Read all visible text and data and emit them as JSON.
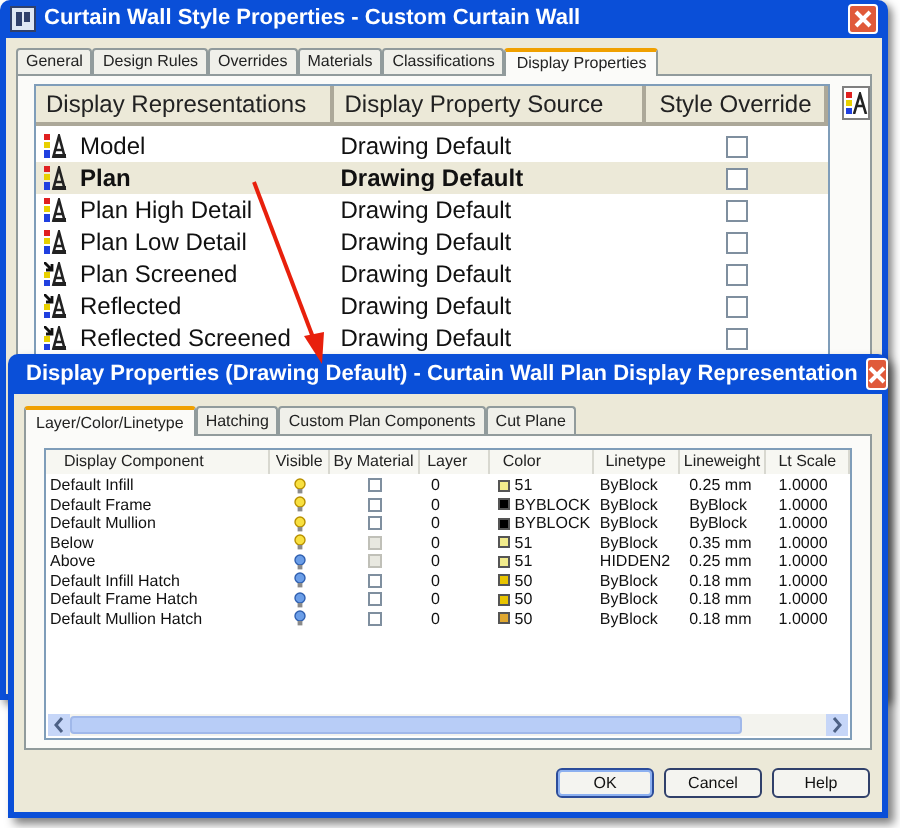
{
  "back_window": {
    "title": "Curtain Wall Style Properties - Custom Curtain Wall",
    "tabs": [
      {
        "label": "General",
        "selected": false
      },
      {
        "label": "Design Rules",
        "selected": false
      },
      {
        "label": "Overrides",
        "selected": false
      },
      {
        "label": "Materials",
        "selected": false
      },
      {
        "label": "Classifications",
        "selected": false
      },
      {
        "label": "Display Properties",
        "selected": true
      }
    ],
    "columns": [
      "Display Representations",
      "Display Property Source",
      "Style Override"
    ],
    "rows": [
      {
        "kind": "standard",
        "name": "Model",
        "source": "Drawing Default",
        "style_override": false,
        "selected": false
      },
      {
        "kind": "standard",
        "name": "Plan",
        "source": "Drawing Default",
        "style_override": false,
        "selected": true
      },
      {
        "kind": "standard",
        "name": "Plan High Detail",
        "source": "Drawing Default",
        "style_override": false,
        "selected": false
      },
      {
        "kind": "standard",
        "name": "Plan Low Detail",
        "source": "Drawing Default",
        "style_override": false,
        "selected": false
      },
      {
        "kind": "screened",
        "name": "Plan Screened",
        "source": "Drawing Default",
        "style_override": false,
        "selected": false
      },
      {
        "kind": "screened",
        "name": "Reflected",
        "source": "Drawing Default",
        "style_override": false,
        "selected": false
      },
      {
        "kind": "screened",
        "name": "Reflected Screened",
        "source": "Drawing Default",
        "style_override": false,
        "selected": false
      }
    ]
  },
  "front_window": {
    "title": "Display Properties (Drawing Default) - Curtain Wall Plan Display Representation",
    "tabs": [
      {
        "label": "Layer/Color/Linetype",
        "selected": true
      },
      {
        "label": "Hatching",
        "selected": false
      },
      {
        "label": "Custom Plan Components",
        "selected": false
      },
      {
        "label": "Cut Plane",
        "selected": false
      }
    ],
    "columns": [
      "Display Component",
      "Visible",
      "By Material",
      "Layer",
      "Color",
      "Linetype",
      "Lineweight",
      "Lt Scale"
    ],
    "rows": [
      {
        "component": "Default Infill",
        "visible": true,
        "by_material": false,
        "by_material_disabled": false,
        "layer": "0",
        "color_text": "51",
        "color": "#f2ec8c",
        "linetype": "ByBlock",
        "lineweight": "0.25 mm",
        "lt_scale": "1.0000"
      },
      {
        "component": "Default Frame",
        "visible": true,
        "by_material": false,
        "by_material_disabled": false,
        "layer": "0",
        "color_text": "BYBLOCK",
        "color": "#000000",
        "linetype": "ByBlock",
        "lineweight": "ByBlock",
        "lt_scale": "1.0000"
      },
      {
        "component": "Default Mullion",
        "visible": true,
        "by_material": false,
        "by_material_disabled": false,
        "layer": "0",
        "color_text": "BYBLOCK",
        "color": "#000000",
        "linetype": "ByBlock",
        "lineweight": "ByBlock",
        "lt_scale": "1.0000"
      },
      {
        "component": "Below",
        "visible": true,
        "by_material": false,
        "by_material_disabled": true,
        "layer": "0",
        "color_text": "51",
        "color": "#f2ec8c",
        "linetype": "ByBlock",
        "lineweight": "0.35 mm",
        "lt_scale": "1.0000"
      },
      {
        "component": "Above",
        "visible": false,
        "by_material": false,
        "by_material_disabled": true,
        "layer": "0",
        "color_text": "51",
        "color": "#f2ec8c",
        "linetype": "HIDDEN2",
        "lineweight": "0.25 mm",
        "lt_scale": "1.0000"
      },
      {
        "component": "Default Infill Hatch",
        "visible": false,
        "by_material": false,
        "by_material_disabled": false,
        "layer": "0",
        "color_text": "50",
        "color": "#e8c400",
        "linetype": "ByBlock",
        "lineweight": "0.18 mm",
        "lt_scale": "1.0000"
      },
      {
        "component": "Default Frame Hatch",
        "visible": false,
        "by_material": false,
        "by_material_disabled": false,
        "layer": "0",
        "color_text": "50",
        "color": "#e8c400",
        "linetype": "ByBlock",
        "lineweight": "0.18 mm",
        "lt_scale": "1.0000"
      },
      {
        "component": "Default Mullion Hatch",
        "visible": false,
        "by_material": false,
        "by_material_disabled": false,
        "layer": "0",
        "color_text": "50",
        "color": "#e0a830",
        "linetype": "ByBlock",
        "lineweight": "0.18 mm",
        "lt_scale": "1.0000"
      }
    ],
    "buttons": [
      "OK",
      "Cancel",
      "Help"
    ]
  }
}
